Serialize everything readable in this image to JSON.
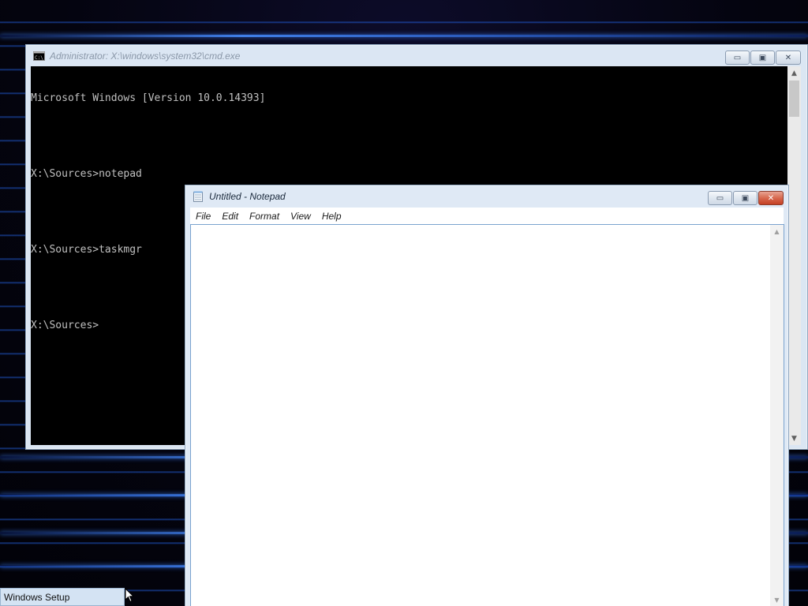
{
  "cmd": {
    "title": "Administrator: X:\\windows\\system32\\cmd.exe",
    "icon": "console-icon",
    "lines": [
      "Microsoft Windows [Version 10.0.14393]",
      "",
      "X:\\Sources>notepad",
      "",
      "X:\\Sources>taskmgr",
      "",
      "X:\\Sources>"
    ],
    "minimize_glyph": "▭",
    "maximize_glyph": "▣",
    "close_glyph": "✕",
    "scroll_up_glyph": "▲",
    "scroll_down_glyph": "▼"
  },
  "notepad": {
    "title": "Untitled - Notepad",
    "icon": "notepad-icon",
    "menu": [
      "File",
      "Edit",
      "Format",
      "View",
      "Help"
    ],
    "content": "",
    "minimize_glyph": "▭",
    "maximize_glyph": "▣",
    "close_glyph": "✕",
    "scroll_up_glyph": "▲",
    "scroll_down_glyph": "▼"
  },
  "taskbar": {
    "tab_label": "Windows Setup"
  },
  "colors": {
    "console_bg": "#000000",
    "console_text": "#c0c0c0",
    "close_button": "#c44125",
    "window_frame": "#dbe6f3"
  }
}
